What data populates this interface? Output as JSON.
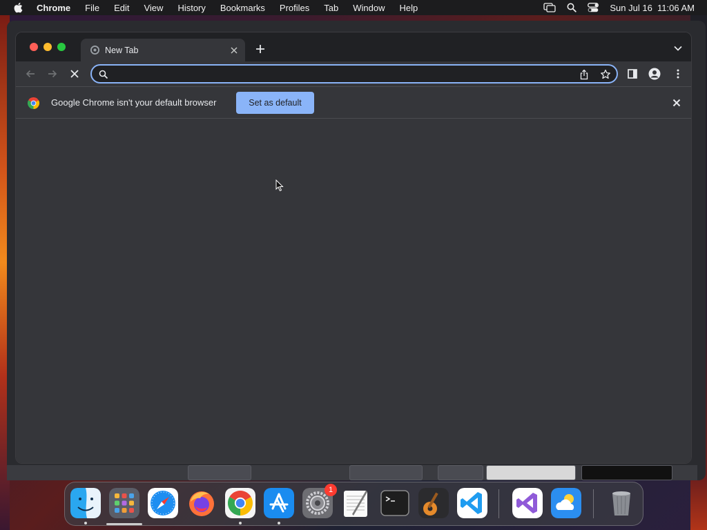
{
  "menubar": {
    "app_name": "Chrome",
    "items": [
      "File",
      "Edit",
      "View",
      "History",
      "Bookmarks",
      "Profiles",
      "Tab",
      "Window",
      "Help"
    ],
    "clock": "Sun Jul 16  11:06 AM"
  },
  "browser": {
    "tab": {
      "title": "New Tab"
    },
    "omnibox": {
      "value": "",
      "placeholder": ""
    },
    "infobar": {
      "message": "Google Chrome isn't your default browser",
      "button_label": "Set as default"
    }
  },
  "dock": {
    "apps": [
      {
        "name": "Finder",
        "icon": "finder-icon",
        "running": true
      },
      {
        "name": "Launchpad",
        "icon": "launchpad-icon",
        "running": false
      },
      {
        "name": "Safari",
        "icon": "safari-icon",
        "running": false
      },
      {
        "name": "Firefox",
        "icon": "firefox-icon",
        "running": false
      },
      {
        "name": "Google Chrome",
        "icon": "chrome-icon",
        "running": true
      },
      {
        "name": "App Store",
        "icon": "app-store-icon",
        "running": true
      },
      {
        "name": "System Settings",
        "icon": "system-settings-icon",
        "running": false,
        "badge": "1"
      },
      {
        "name": "TextEdit",
        "icon": "textedit-icon",
        "running": false
      },
      {
        "name": "Terminal",
        "icon": "terminal-icon",
        "running": false
      },
      {
        "name": "GarageBand",
        "icon": "garageband-icon",
        "running": false
      },
      {
        "name": "Visual Studio Code",
        "icon": "vscode-icon",
        "running": false
      },
      {
        "name": "Visual Studio",
        "icon": "visual-studio-icon",
        "running": false
      },
      {
        "name": "Weather",
        "icon": "weather-icon",
        "running": false
      },
      {
        "name": "Trash",
        "icon": "trash-icon",
        "running": false
      }
    ]
  },
  "colors": {
    "accent": "#8ab4f8",
    "toolbar": "#35363a",
    "tabstrip": "#202124",
    "menubar": "#1c1c1e"
  }
}
